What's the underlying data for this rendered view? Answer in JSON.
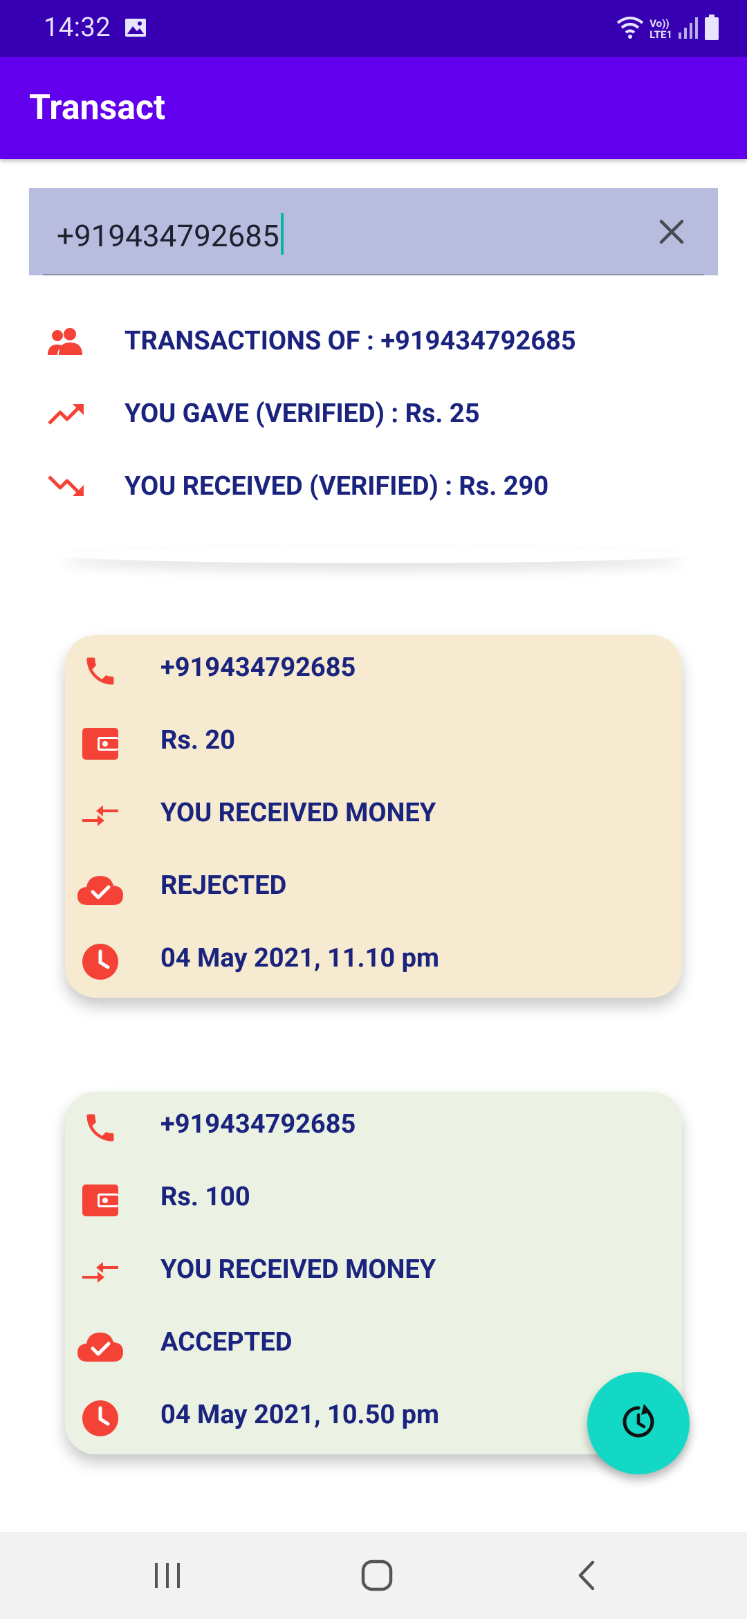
{
  "status_bar": {
    "time": "14:32",
    "icons": [
      "gallery-icon",
      "wifi-icon",
      "volte-icon",
      "signal-icon",
      "battery-icon"
    ],
    "volte_top": "Vo))",
    "volte_bottom": "LTE1"
  },
  "app_bar": {
    "title": "Transact"
  },
  "search": {
    "value": "+919434792685",
    "clear_icon": "close-icon"
  },
  "summary": {
    "transactions_of": "TRANSACTIONS OF : +919434792685",
    "you_gave": "YOU GAVE (VERIFIED) : Rs. 25",
    "you_received": "YOU RECEIVED (VERIFIED) : Rs. 290"
  },
  "transactions": [
    {
      "phone": "+919434792685",
      "amount": "Rs. 20",
      "direction": "YOU RECEIVED MONEY",
      "status": "REJECTED",
      "datetime": "04 May 2021, 11.10 pm",
      "background": "#f6ebd0"
    },
    {
      "phone": "+919434792685",
      "amount": "Rs. 100",
      "direction": "YOU RECEIVED MONEY",
      "status": "ACCEPTED",
      "datetime": "04 May 2021, 10.50 pm",
      "background": "#ebf2e3"
    }
  ],
  "fab": {
    "icon": "refresh-history-icon"
  },
  "nav": {
    "buttons": [
      "recents-icon",
      "home-icon",
      "back-icon"
    ]
  },
  "colors": {
    "status_bar": "#3700b3",
    "app_bar": "#6200ee",
    "accent_icon": "#f44336",
    "text_primary": "#1a237e",
    "fab": "#14d8c6"
  }
}
